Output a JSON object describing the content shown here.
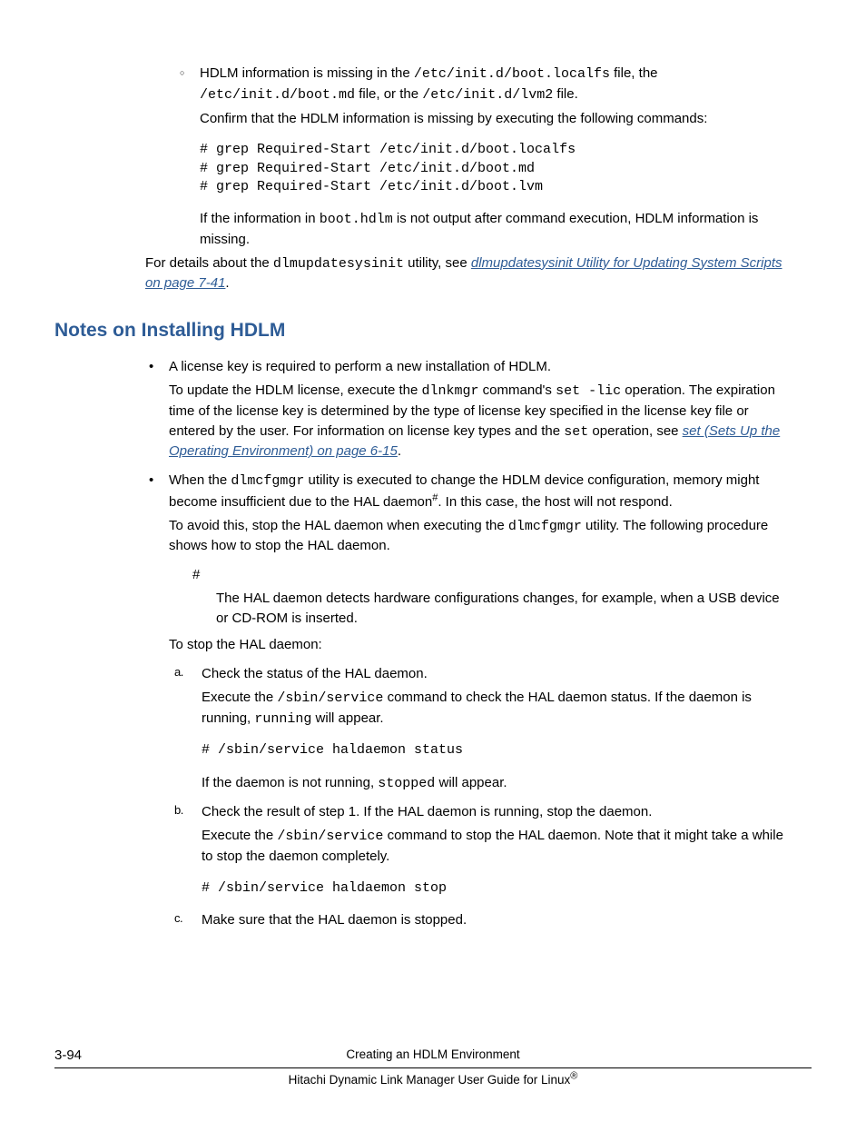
{
  "top": {
    "line1a": "HDLM information is missing in the ",
    "c1": "/etc/init.d/boot.localfs",
    "line1b": " file, the ",
    "c2": "/etc/init.d/boot.md",
    "line1c": " file, or the ",
    "c3": "/etc/init.d/lvm2",
    "line1d": " file.",
    "confirm": "Confirm that the HDLM information is missing by executing the following commands:",
    "code1": "# grep Required-Start /etc/init.d/boot.localfs\n# grep Required-Start /etc/init.d/boot.md\n# grep Required-Start /etc/init.d/boot.lvm",
    "after1a": "If the information in ",
    "after1b": "boot.hdlm",
    "after1c": " is not output after command execution, HDLM information is missing.",
    "details1": "For details about the ",
    "details_code": "dlmupdatesysinit",
    "details2": " utility, see ",
    "details_link": "dlmupdatesysinit Utility for Updating System Scripts on page 7-41",
    "details3": "."
  },
  "heading": "Notes on Installing HDLM",
  "b1": {
    "p1": "A license key is required to perform a new installation of HDLM.",
    "p2a": "To update the HDLM license, execute the ",
    "p2code1": "dlnkmgr",
    "p2b": " command's ",
    "p2code2": "set -lic",
    "p2c": " operation. The expiration time of the license key is determined by the type of license key specified in the license key file or entered by the user. For information on license key types and the ",
    "p2code3": "set",
    "p2d": " operation, see ",
    "p2link": "set (Sets Up the Operating Environment) on page 6-15",
    "p2e": "."
  },
  "b2": {
    "p1a": "When the ",
    "p1code": "dlmcfgmgr",
    "p1b": " utility is executed to change the HDLM device configuration, memory might become insufficient due to the HAL daemon",
    "p1c": ". In this case, the host will not respond.",
    "p2a": "To avoid this, stop the HAL daemon when executing the ",
    "p2code": "dlmcfgmgr",
    "p2b": " utility. The following procedure shows how to stop the HAL daemon.",
    "hash": "#",
    "hashtext": "The HAL daemon detects hardware configurations changes, for example, when a USB device or CD-ROM is inserted.",
    "tostop": "To stop the HAL daemon:",
    "a": {
      "marker": "a.",
      "t1": "Check the status of the HAL daemon.",
      "t2a": "Execute the ",
      "t2code": "/sbin/service",
      "t2b": " command to check the HAL daemon status. If the daemon is running, ",
      "t2code2": "running",
      "t2c": " will appear.",
      "codeA": "# /sbin/service haldaemon status",
      "t3a": "If the daemon is not running, ",
      "t3code": "stopped",
      "t3b": " will appear."
    },
    "b": {
      "marker": "b.",
      "t1": "Check the result of step 1. If the HAL daemon is running, stop the daemon.",
      "t2a": "Execute the ",
      "t2code": "/sbin/service",
      "t2b": " command to stop the HAL daemon. Note that it might take a while to stop the daemon completely.",
      "codeB": "# /sbin/service haldaemon stop"
    },
    "c": {
      "marker": "c.",
      "t1": "Make sure that the HAL daemon is stopped."
    }
  },
  "footer": {
    "pagenum": "3-94",
    "title": "Creating an HDLM Environment",
    "subtitle1": "Hitachi Dynamic Link Manager User Guide for Linux",
    "reg": "®"
  }
}
